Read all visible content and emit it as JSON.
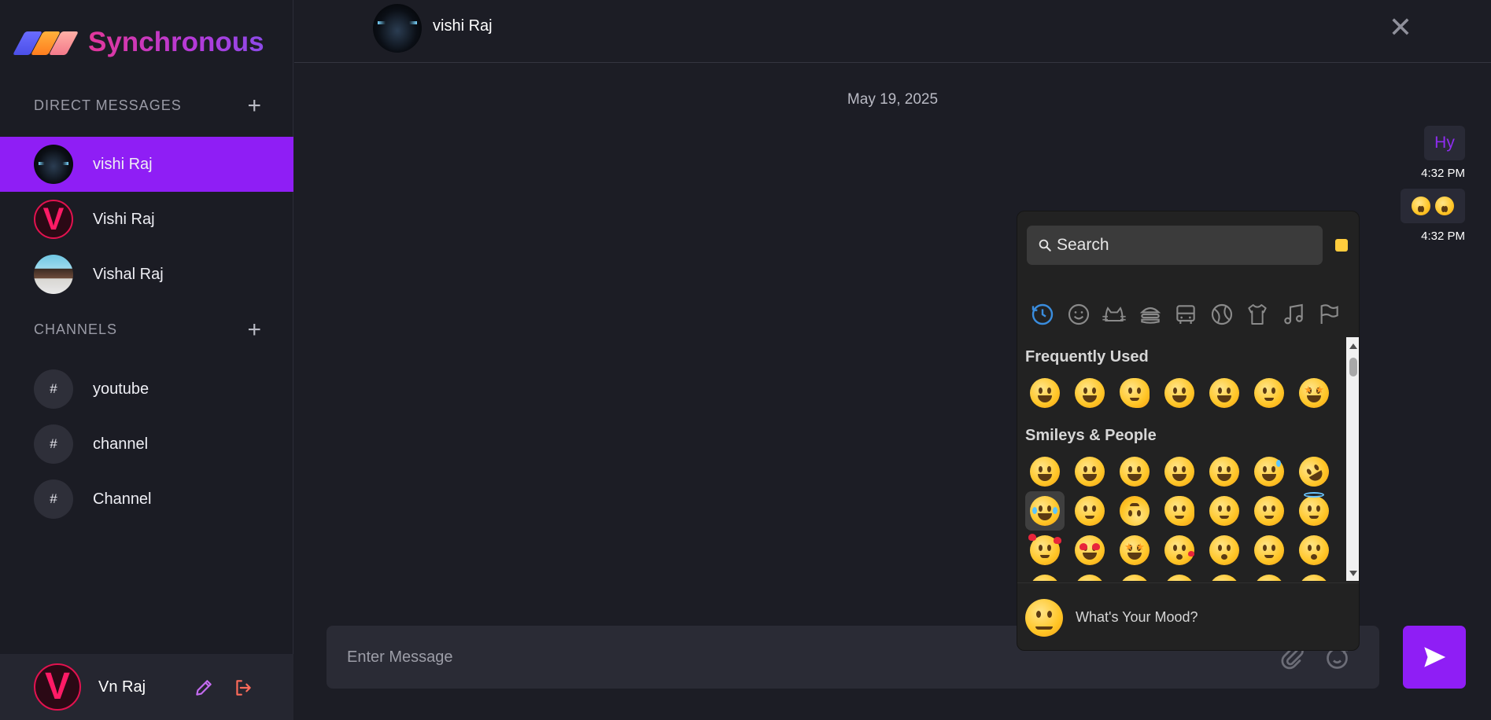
{
  "app": {
    "title": "Synchronous"
  },
  "sidebar": {
    "dm_heading": "DIRECT MESSAGES",
    "channels_heading": "CHANNELS",
    "contacts": [
      {
        "name": "vishi Raj",
        "avatar": "car-photo",
        "active": true
      },
      {
        "name": "Vishi Raj",
        "avatar": "letter-v",
        "active": false
      },
      {
        "name": "Vishal Raj",
        "avatar": "person-photo",
        "active": false
      }
    ],
    "channels": [
      {
        "symbol": "#",
        "name": "youtube"
      },
      {
        "symbol": "#",
        "name": "channel"
      },
      {
        "symbol": "#",
        "name": "Channel"
      }
    ],
    "profile": {
      "name": "Vn Raj",
      "avatar_letter": "V"
    }
  },
  "chat": {
    "header_name": "vishi Raj",
    "close_symbol": "✕",
    "date": "May 19, 2025",
    "messages": [
      {
        "text": "Hy",
        "time": "4:32 PM"
      },
      {
        "emojis": [
          "grimacing-face",
          "squinting-tongue-face"
        ],
        "time": "4:32 PM"
      }
    ]
  },
  "composer": {
    "placeholder": "Enter Message"
  },
  "emoji_picker": {
    "search_placeholder": "Search",
    "skin_tone_color": "#ffcc3d",
    "categories": [
      "recent-icon",
      "smiley-icon",
      "animal-icon",
      "food-icon",
      "travel-icon",
      "activity-icon",
      "objects-icon",
      "symbols-icon",
      "flags-icon"
    ],
    "sections": [
      {
        "title": "Frequently Used"
      },
      {
        "title": "Smileys & People"
      }
    ],
    "preview_text": "What's Your Mood?"
  },
  "colors": {
    "accent": "#8f1ef5",
    "logout": "#ff6b5a",
    "edit": "#c46bf0"
  }
}
